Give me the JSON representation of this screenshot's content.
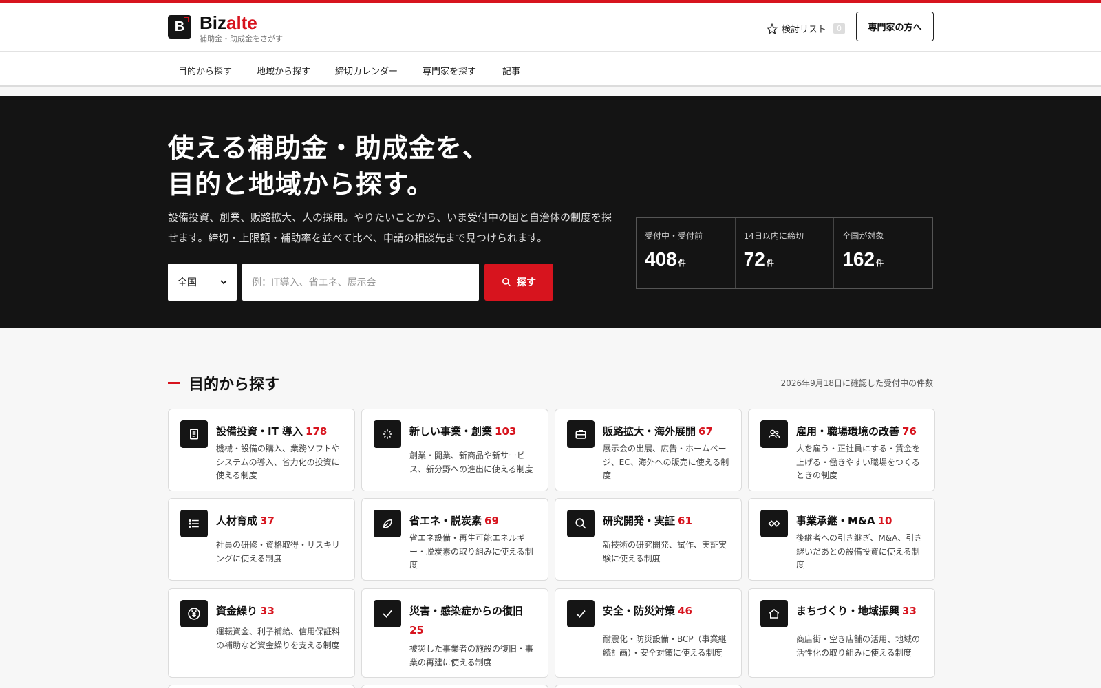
{
  "brand": {
    "name_a": "Biz",
    "name_b": "alte",
    "tagline": "補助金・助成金をさがす",
    "mark": "B"
  },
  "header": {
    "wishlist_label": "検討リスト",
    "wishlist_count": "0",
    "expert_button": "専門家の方へ"
  },
  "nav": {
    "items": [
      "目的から探す",
      "地域から探す",
      "締切カレンダー",
      "専門家を探す",
      "記事"
    ]
  },
  "hero": {
    "title_line1": "使える補助金・助成金を、",
    "title_line2": "目的と地域から探す。",
    "desc_line1": "設備投資、創業、販路拡大、人の採用。やりたいことから、いま受付中の国と自治体の制度を探",
    "desc_line2": "せます。締切・上限額・補助率を並べて比べ、申請の相談先まで見つけられます。",
    "region_value": "全国",
    "search_placeholder": "例：IT導入、省エネ、展示会",
    "search_button": "探す",
    "stats": [
      {
        "label": "受付中・受付前",
        "value": "408",
        "unit": "件"
      },
      {
        "label": "14日以内に締切",
        "value": "72",
        "unit": "件"
      },
      {
        "label": "全国が対象",
        "value": "162",
        "unit": "件"
      }
    ]
  },
  "purpose": {
    "title": "目的から探す",
    "note": "2026年9月18日に確認した受付中の件数",
    "cards": [
      {
        "title": "設備投資・IT 導入",
        "count": "178",
        "desc": "機械・設備の購入、業務ソフトやシステムの導入、省力化の投資に使える制度",
        "icon": "document-icon"
      },
      {
        "title": "新しい事業・創業",
        "count": "103",
        "desc": "創業・開業、新商品や新サービス、新分野への進出に使える制度",
        "icon": "spark-icon"
      },
      {
        "title": "販路拡大・海外展開",
        "count": "67",
        "desc": "展示会の出展、広告・ホームページ、EC、海外への販売に使える制度",
        "icon": "briefcase-icon"
      },
      {
        "title": "雇用・職場環境の改善",
        "count": "76",
        "desc": "人を雇う・正社員にする・賃金を上げる・働きやすい職場をつくるときの制度",
        "icon": "users-icon"
      },
      {
        "title": "人材育成",
        "count": "37",
        "desc": "社員の研修・資格取得・リスキリングに使える制度",
        "icon": "list-icon"
      },
      {
        "title": "省エネ・脱炭素",
        "count": "69",
        "desc": "省エネ設備・再生可能エネルギー・脱炭素の取り組みに使える制度",
        "icon": "leaf-icon"
      },
      {
        "title": "研究開発・実証",
        "count": "61",
        "desc": "新技術の研究開発、試作、実証実験に使える制度",
        "icon": "search-icon"
      },
      {
        "title": "事業承継・M&A",
        "count": "10",
        "desc": "後継者への引き継ぎ、M&A、引き継いだあとの設備投資に使える制度",
        "icon": "handshake-icon"
      },
      {
        "title": "資金繰り",
        "count": "33",
        "desc": "運転資金、利子補給、信用保証料の補助など資金繰りを支える制度",
        "icon": "yen-icon"
      },
      {
        "title": "災害・感染症からの復旧",
        "count": "25",
        "desc": "被災した事業者の施設の復旧・事業の再建に使える制度",
        "icon": "check-icon"
      },
      {
        "title": "安全・防災対策",
        "count": "46",
        "desc": "耐震化・防災設備・BCP（事業継続計画）・安全対策に使える制度",
        "icon": "check-icon"
      },
      {
        "title": "まちづくり・地域振興",
        "count": "33",
        "desc": "商店街・空き店舗の活用、地域の活性化の取り組みに使える制度",
        "icon": "home-icon"
      }
    ]
  }
}
